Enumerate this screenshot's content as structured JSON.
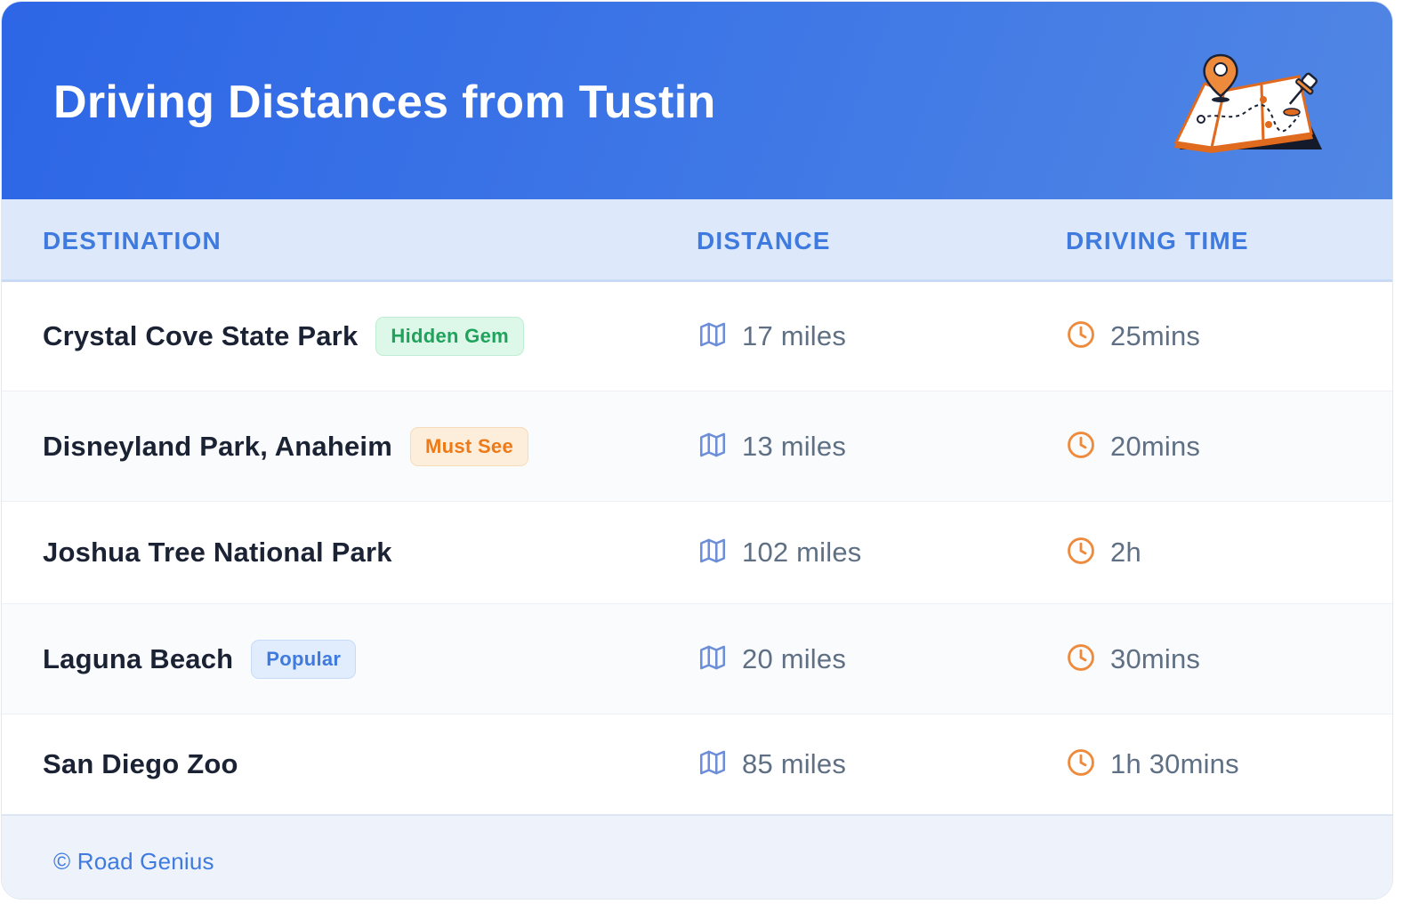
{
  "header": {
    "title": "Driving Distances from Tustin",
    "illustration": "folded-map-with-location-pin-icon"
  },
  "table": {
    "columns": [
      "DESTINATION",
      "DISTANCE",
      "DRIVING TIME"
    ],
    "rows": [
      {
        "destination": "Crystal Cove State Park",
        "badge": "Hidden Gem",
        "badge_color": "#1fa35c",
        "distance": "17 miles",
        "time": "25mins"
      },
      {
        "destination": "Disneyland Park, Anaheim",
        "badge": "Must See",
        "badge_color": "#ee7a17",
        "distance": "13 miles",
        "time": "20mins"
      },
      {
        "destination": "Joshua Tree National Park",
        "badge": "",
        "distance": "102 miles",
        "time": "2h"
      },
      {
        "destination": "Laguna Beach",
        "badge": "Popular",
        "badge_color": "#3f7adf",
        "distance": "20 miles",
        "time": "30mins"
      },
      {
        "destination": "San Diego Zoo",
        "badge": "",
        "distance": "85 miles",
        "time": "1h 30mins"
      }
    ],
    "distance_icon": "map-icon",
    "time_icon": "clock-icon"
  },
  "footer": {
    "credit": "© Road Genius"
  },
  "colors": {
    "header_gradient_start": "#2d66e6",
    "header_gradient_end": "#5186e4",
    "accent_blue": "#3f7adf",
    "clock_orange": "#ee8a3c"
  }
}
